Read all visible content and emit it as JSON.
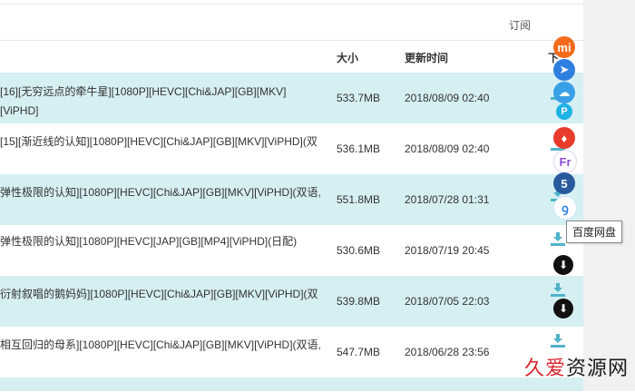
{
  "header": {
    "subscribe_label": "订阅"
  },
  "table": {
    "columns": {
      "size": "大小",
      "time": "更新时间",
      "download": "下"
    },
    "rows": [
      {
        "title": "[16][无穷远点的牵牛星][1080P][HEVC][Chi&JAP][GB][MKV][ViPHD]",
        "size": "533.7MB",
        "time": "2018/08/09 02:40"
      },
      {
        "title": "[15][渐近线的认知][1080P][HEVC][Chi&JAP][GB][MKV][ViPHD](双",
        "size": "536.1MB",
        "time": "2018/08/09 02:40"
      },
      {
        "title": "弹性极限的认知][1080P][HEVC][Chi&JAP][GB][MKV][ViPHD](双语,",
        "size": "551.8MB",
        "time": "2018/07/28 01:31"
      },
      {
        "title": "弹性极限的认知][1080P][HEVC][JAP][GB][MP4][ViPHD](日配)",
        "size": "530.6MB",
        "time": "2018/07/19 20:45"
      },
      {
        "title": "衍射叙唱的鹅妈妈][1080P][HEVC][Chi&JAP][GB][MKV][ViPHD](双",
        "size": "539.8MB",
        "time": "2018/07/05 22:03"
      },
      {
        "title": "相互回归的母系][1080P][HEVC][Chi&JAP][GB][MKV][ViPHD](双语,",
        "size": "547.7MB",
        "time": "2018/06/28 23:56"
      },
      {
        "title": "",
        "size": "",
        "time": ""
      }
    ]
  },
  "share_menu": {
    "items": [
      {
        "icon": "xiaomi-icon",
        "glyph": "mi",
        "color": "#f56b1c"
      },
      {
        "icon": "send-icon",
        "glyph": "➤",
        "color": "#2f7fe0"
      },
      {
        "icon": "cloud-icon",
        "glyph": "☁",
        "color": "#39a0e8"
      },
      {
        "icon": "p-icon",
        "glyph": "P",
        "color": "#1eb3e6"
      },
      {
        "icon": "douban-icon",
        "glyph": "♦",
        "color": "#e83b2c"
      },
      {
        "icon": "fr-icon",
        "glyph": "Fr",
        "color": "#ffffff"
      },
      {
        "icon": "five-icon",
        "glyph": "5",
        "color": "#2a5a9e"
      },
      {
        "icon": "baidu-pan-icon",
        "glyph": "ꝯ",
        "color": "#ffffff"
      }
    ],
    "tooltip": "百度网盘"
  },
  "watermark": {
    "text_accent": "久爱",
    "text_rest": "资源网"
  }
}
